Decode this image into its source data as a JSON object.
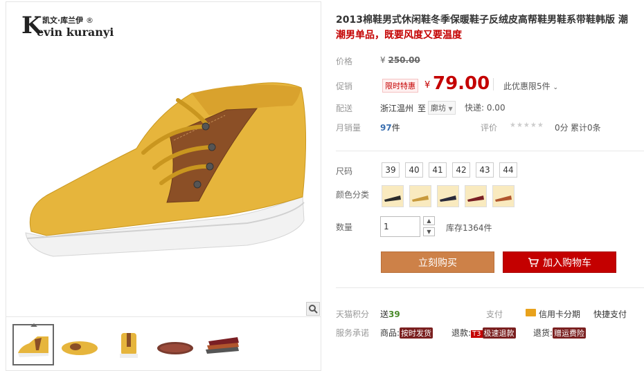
{
  "brand": {
    "k_letter": "K",
    "cn_name": "凯文·库兰伊",
    "reg": "®",
    "en_name": "evin kuranyi"
  },
  "product": {
    "title": "2013棉鞋男式休闲鞋冬季保暖鞋子反绒皮高帮鞋男鞋系带鞋韩版 潮",
    "subtitle": "潮男单品，既要风度又要温度"
  },
  "price": {
    "label": "价格",
    "currency": "¥",
    "original": "250.00",
    "promo_label": "促销",
    "promo_tag": "限时特惠",
    "current": "79.00",
    "limit_text": "此优惠限5件",
    "limit_chevron": "chevron-down-icon"
  },
  "shipping": {
    "label": "配送",
    "from": "浙江温州",
    "to_label": "至",
    "destination": "廓坊",
    "fee": "快递: 0.00"
  },
  "sales": {
    "label": "月销量",
    "count": "97",
    "unit": "件",
    "rating_label": "评价",
    "score": "0分",
    "total": "累计0条"
  },
  "sizes": {
    "label": "尺码",
    "options": [
      "39",
      "40",
      "41",
      "42",
      "43",
      "44"
    ]
  },
  "colors": {
    "label": "颜色分类",
    "swatches": [
      "#2b2b2b",
      "#c89a3c",
      "#2a2a3a",
      "#7a1f24",
      "#b0552d"
    ]
  },
  "quantity": {
    "label": "数量",
    "value": "1",
    "stock": "库存1364件"
  },
  "actions": {
    "buy_now": "立刻购买",
    "add_to_cart": "加入购物车"
  },
  "points": {
    "label": "天猫积分",
    "send": "送",
    "value": "39"
  },
  "payment": {
    "label": "支付",
    "credit": "信用卡分期",
    "quick": "快捷支付"
  },
  "service": {
    "label": "服务承诺",
    "goods_label": "商品:",
    "goods_badge": "按时发货",
    "refund_label": "退款:",
    "refund_tag": "T3",
    "refund_badge": "极速退款",
    "return_label": "退货:",
    "return_badge": "赠运费险"
  },
  "colors_ui": {
    "accent_red": "#c40000",
    "buy_orange": "#cd8148"
  }
}
